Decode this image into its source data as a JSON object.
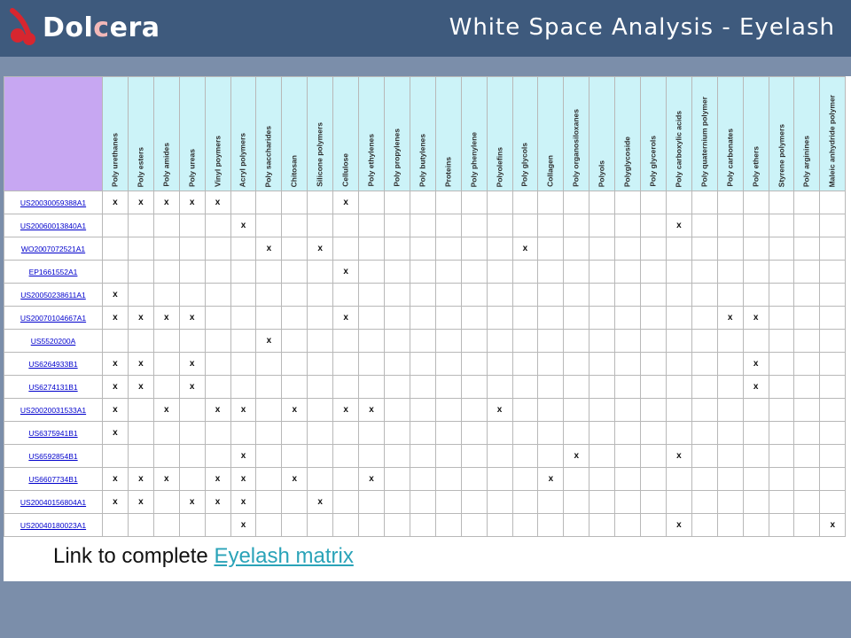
{
  "header": {
    "brand": "Dolcera",
    "title": "White Space Analysis - Eyelash",
    "colors": {
      "header": "#3e5a7d",
      "band": "#7b8eaa",
      "link": "#2aa3b8",
      "corner": "#c7a7f2",
      "column_header": "#ccf3f8"
    }
  },
  "matrix": {
    "columns": [
      "Poly urethanes",
      "Poly esters",
      "Poly amides",
      "Poly ureas",
      "Vinyl poymers",
      "Acryl polymers",
      "Poly saccharides",
      "Chitosan",
      "Silicone polymers",
      "Cellulose",
      "Poly ethylenes",
      "Poly propylenes",
      "Poly butylenes",
      "Proteins",
      "Poly phenylene",
      "Polyolefins",
      "Poly glycols",
      "Collagen",
      "Poly organosiloxanes",
      "Polyols",
      "Polyglycoside",
      "Poly glycerols",
      "Poly carboxylic acids",
      "Poly quaternium polymer",
      "Poly carbonates",
      "Poly ethers",
      "Styrene polymers",
      "Poly arginines",
      "Maleic anhydride polymer"
    ],
    "rows": [
      {
        "id": "US20030059388A1",
        "marks": [
          0,
          1,
          2,
          3,
          4,
          9
        ]
      },
      {
        "id": "US20060013840A1",
        "marks": [
          5,
          22
        ]
      },
      {
        "id": "WO2007072521A1",
        "marks": [
          6,
          8,
          16
        ]
      },
      {
        "id": "EP1661552A1",
        "marks": [
          9
        ]
      },
      {
        "id": "US20050238611A1",
        "marks": [
          0
        ]
      },
      {
        "id": "US20070104667A1",
        "marks": [
          0,
          1,
          2,
          3,
          9,
          24,
          25
        ]
      },
      {
        "id": "US5520200A",
        "marks": [
          6
        ]
      },
      {
        "id": "US6264933B1",
        "marks": [
          0,
          1,
          3,
          25
        ]
      },
      {
        "id": "US6274131B1",
        "marks": [
          0,
          1,
          3,
          25
        ]
      },
      {
        "id": "US20020031533A1",
        "marks": [
          0,
          2,
          4,
          5,
          7,
          9,
          10,
          15
        ]
      },
      {
        "id": "US6375941B1",
        "marks": [
          0
        ]
      },
      {
        "id": "US6592854B1",
        "marks": [
          5,
          18,
          22
        ]
      },
      {
        "id": "US6607734B1",
        "marks": [
          0,
          1,
          2,
          4,
          5,
          7,
          10,
          17
        ]
      },
      {
        "id": "US20040156804A1",
        "marks": [
          0,
          1,
          3,
          4,
          5,
          8
        ]
      },
      {
        "id": "US20040180023A1",
        "marks": [
          5,
          22,
          28
        ]
      }
    ],
    "mark_symbol": "x"
  },
  "footer": {
    "prefix": "Link to complete ",
    "link_text": "Eyelash matrix"
  }
}
